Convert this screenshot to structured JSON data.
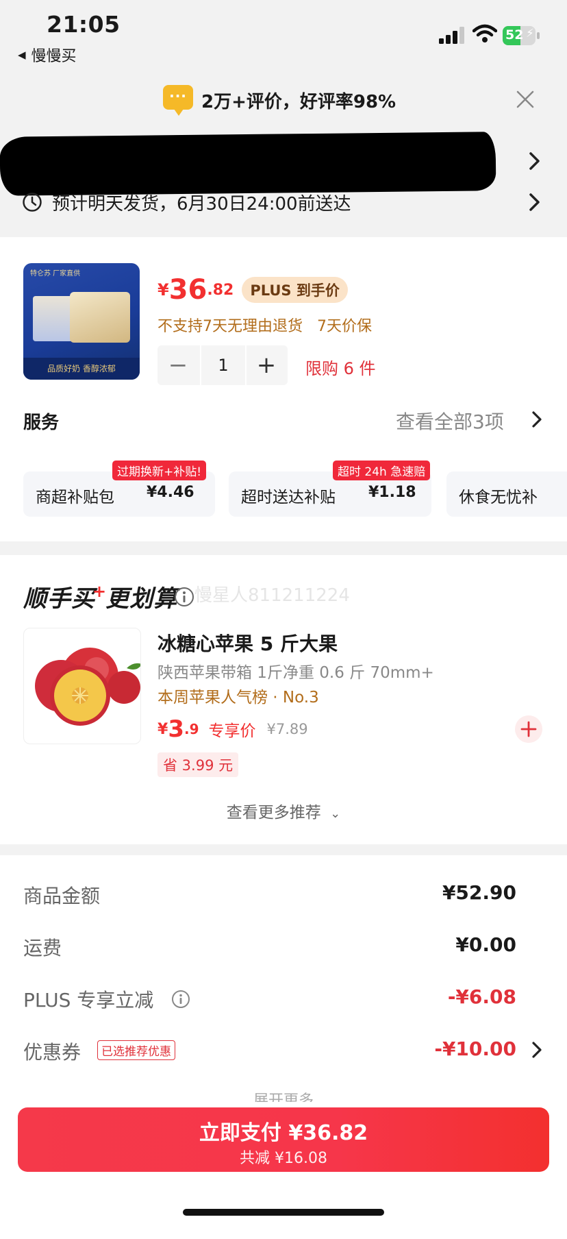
{
  "status_bar": {
    "time": "21:05",
    "back_app": "慢慢买",
    "battery": "52"
  },
  "review_banner": {
    "text": "2万+评价，好评率98%",
    "icon": "chat-bubble-icon"
  },
  "delivery": {
    "text": "预计明天发货，6月30日24:00前送达"
  },
  "product": {
    "price_symbol": "¥",
    "price_int": "36",
    "price_dec": ".82",
    "plus_badge": "PLUS 到手价",
    "return_note": "不支持7天无理由退货   7天价保",
    "quantity": "1",
    "limit": "限购 6 件",
    "image_band_text": "品质好奶 香醇浓郁",
    "image_top_text": "特仑苏 厂家直供"
  },
  "services": {
    "title": "服务",
    "view_all": "查看全部3项",
    "items": [
      {
        "name": "商超补贴包",
        "price": "¥4.46",
        "tag": "过期换新+补贴!"
      },
      {
        "name": "超时送达补贴",
        "price": "¥1.18",
        "tag": "超时 24h 急速赔"
      },
      {
        "name": "休食无忧补",
        "price": "",
        "tag": ""
      }
    ]
  },
  "recommend": {
    "title_a": "顺手买",
    "title_plus": "+",
    "title_b": "更划算",
    "watermark": "慢星人811211224",
    "item": {
      "name": "冰糖心苹果 5 斤大果",
      "desc": "陕西苹果带箱 1斤净重 0.6 斤 70mm+",
      "rank": "本周苹果人气榜 · No.3",
      "price_symbol": "¥",
      "price_int": "3",
      "price_dec": ".9",
      "price_label": "专享价",
      "orig_price": "¥7.89",
      "save": "省 3.99 元"
    },
    "more": "查看更多推荐"
  },
  "summary": {
    "rows": [
      {
        "label": "商品金额",
        "value": "¥52.90"
      },
      {
        "label": "运费",
        "value": "¥0.00"
      },
      {
        "label": "PLUS 专享立减",
        "value": "-¥6.08"
      },
      {
        "label": "优惠券",
        "value": "-¥10.00",
        "tag": "已选推荐优惠"
      }
    ],
    "expand": "展开更多"
  },
  "pay": {
    "label": "立即支付 ¥36.82",
    "sub": "共减 ¥16.08"
  },
  "colors": {
    "accent_red": "#f23030",
    "gold": "#b26d1b",
    "plus_badge_bg": "#fbe3c8"
  }
}
